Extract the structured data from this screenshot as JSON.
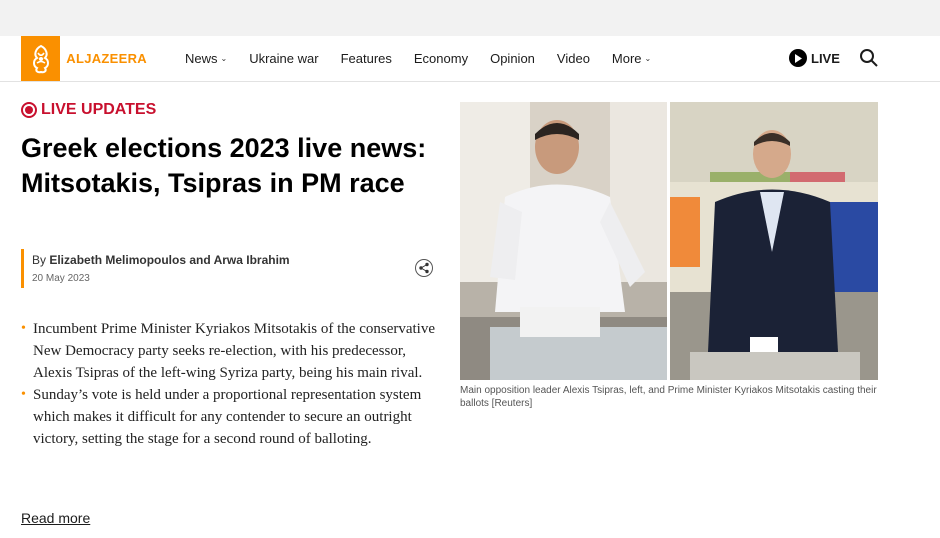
{
  "header": {
    "logo_text": "ALJAZEERA",
    "nav": [
      {
        "label": "News",
        "dropdown": true
      },
      {
        "label": "Ukraine war",
        "dropdown": false
      },
      {
        "label": "Features",
        "dropdown": false
      },
      {
        "label": "Economy",
        "dropdown": false
      },
      {
        "label": "Opinion",
        "dropdown": false
      },
      {
        "label": "Video",
        "dropdown": false
      },
      {
        "label": "More",
        "dropdown": true
      }
    ],
    "live_label": "LIVE",
    "search_icon": "search-icon"
  },
  "article": {
    "tag": "LIVE UPDATES",
    "headline": "Greek elections 2023 live news: Mitsotakis, Tsipras in PM race",
    "byline_prefix": "By ",
    "authors": "Elizabeth Melimopoulos and Arwa Ibrahim",
    "date": "20 May 2023",
    "summary": [
      "Incumbent Prime Minister Kyriakos Mitsotakis of the conservative New Democracy party seeks re-election, with his predecessor, Alexis Tsipras of the left-wing Syriza party, being his main rival.",
      "Sunday’s vote is held under a proportional representation system which makes it difficult for any contender to secure an outright victory, setting the stage for a second round of balloting."
    ],
    "read_more": "Read more",
    "image_caption": "Main opposition leader Alexis Tsipras, left, and Prime Minister Kyriakos Mitsotakis casting their ballots [Reuters]"
  },
  "colors": {
    "brand": "#fa9000",
    "live": "#c8102e"
  }
}
